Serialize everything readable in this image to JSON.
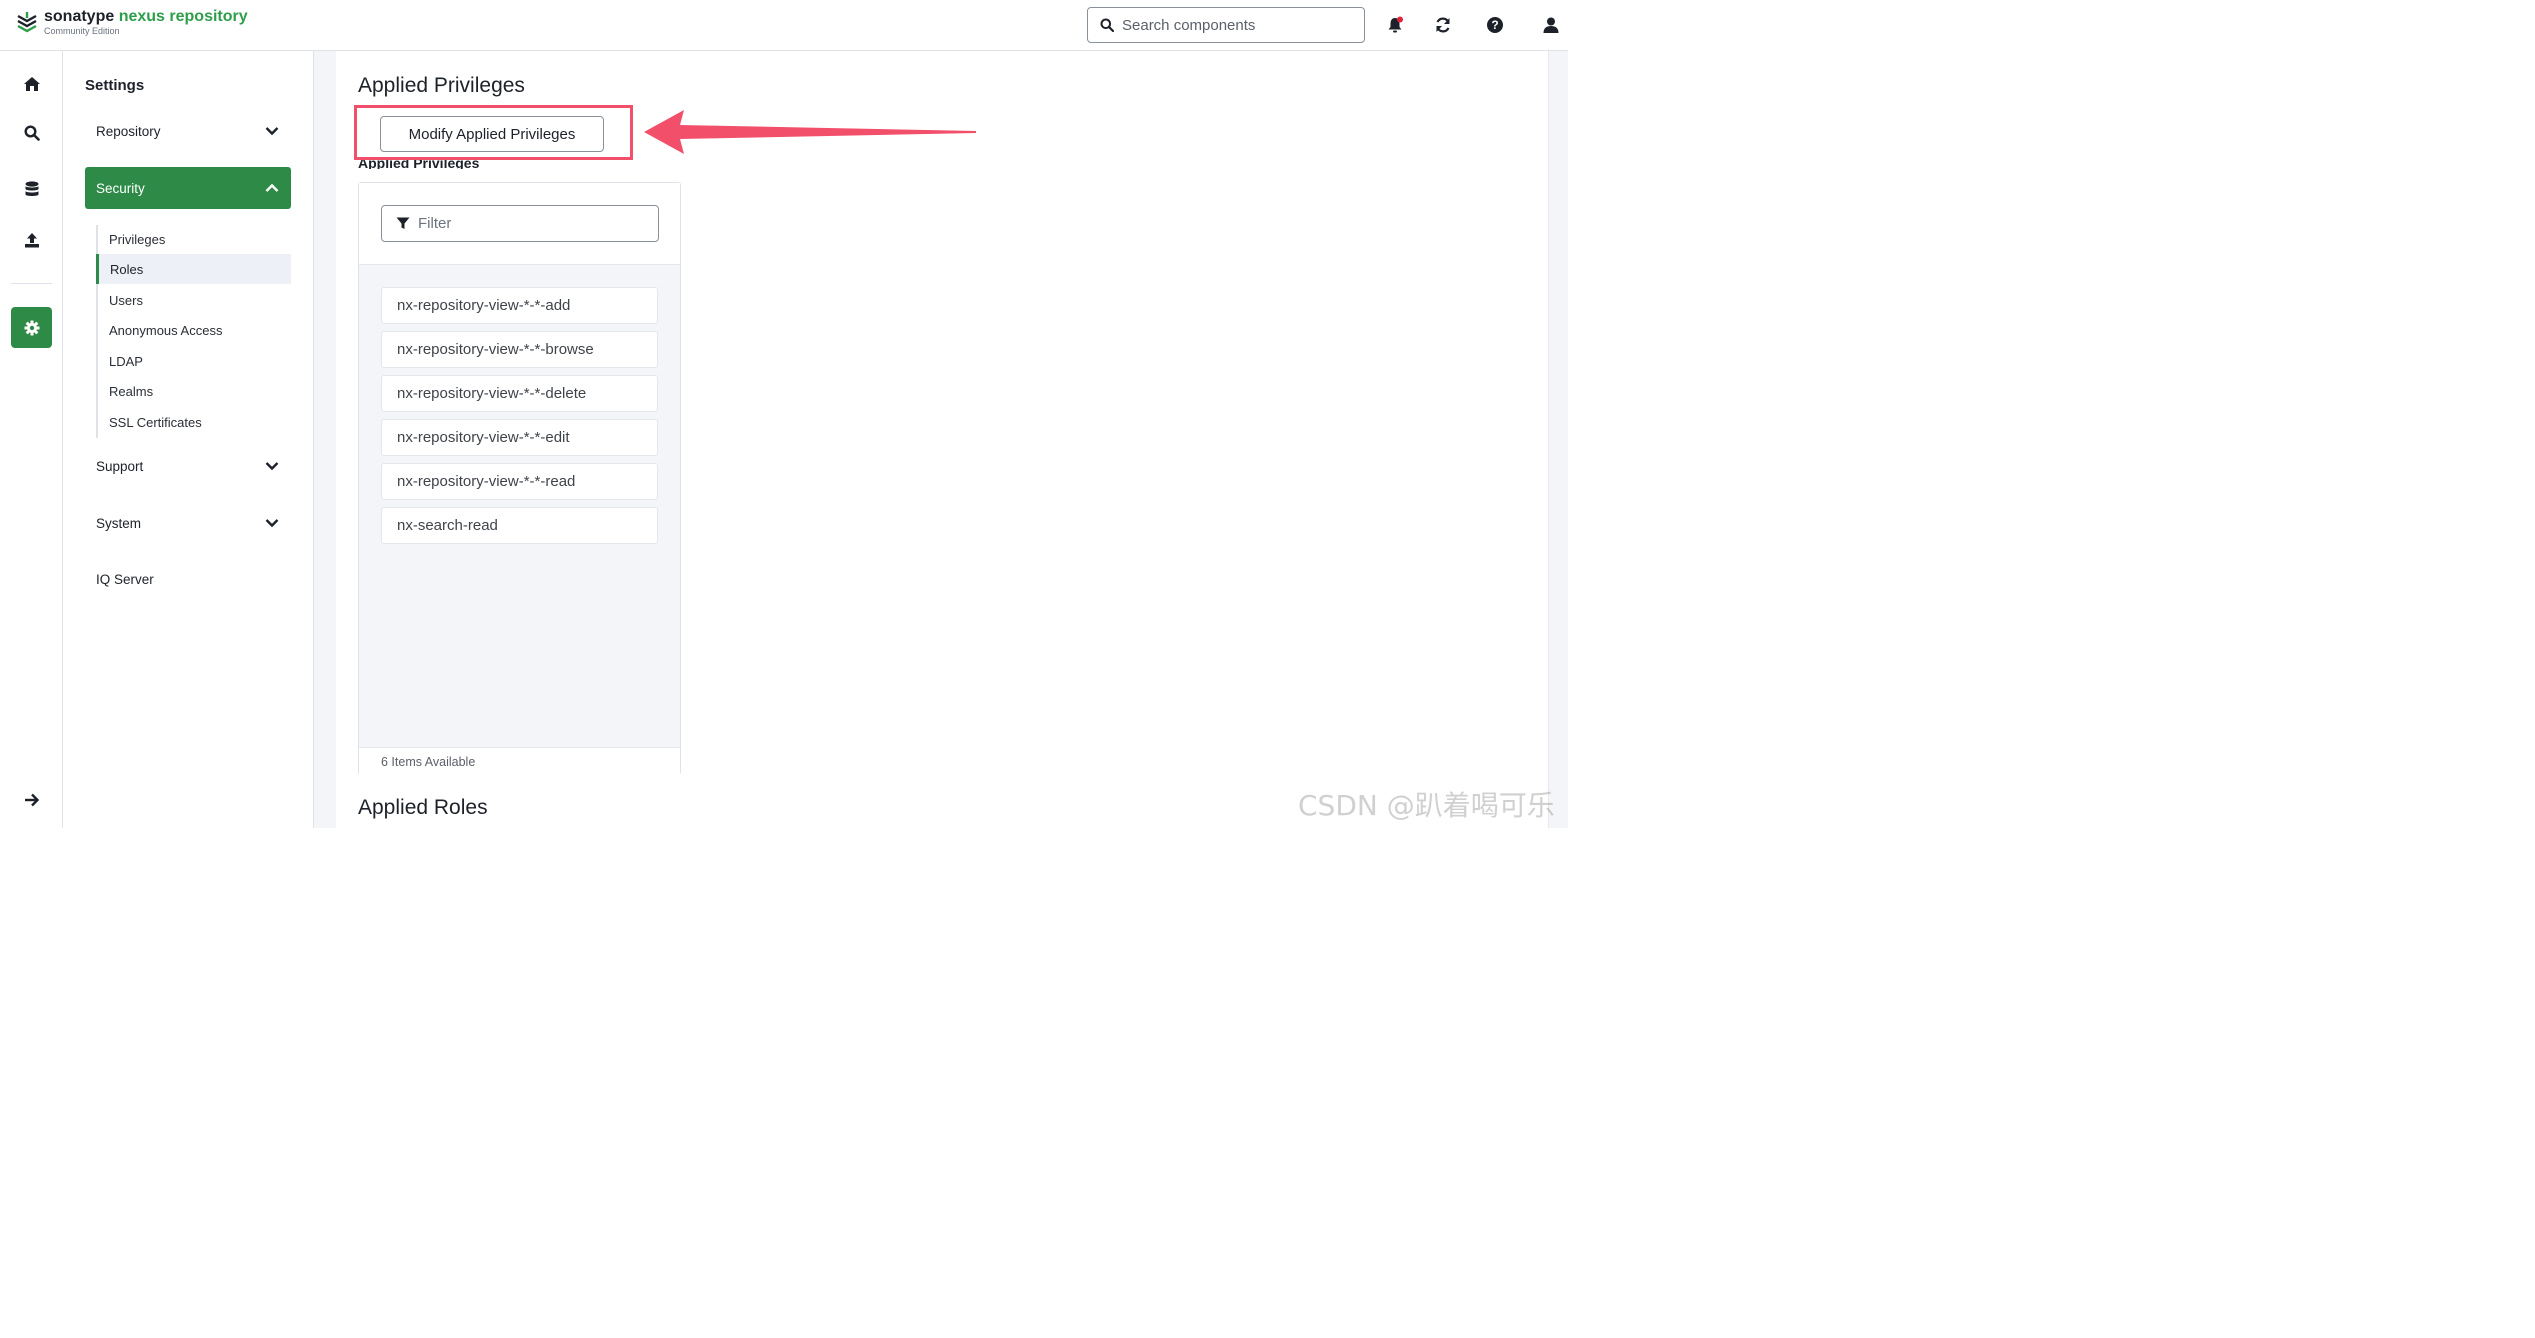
{
  "brand": {
    "name_part1": "sonatype",
    "name_part2": "nexus repository",
    "edition": "Community Edition"
  },
  "header": {
    "search_placeholder": "Search components",
    "icons": [
      "bell-icon",
      "refresh-icon",
      "help-icon",
      "user-icon"
    ]
  },
  "rail": {
    "icons": [
      "home-icon",
      "search-icon",
      "database-icon",
      "upload-icon",
      "gear-icon",
      "expand-arrow-icon"
    ],
    "active": "gear-icon"
  },
  "sidebar": {
    "title": "Settings",
    "sections": [
      {
        "label": "Repository",
        "expanded": false
      },
      {
        "label": "Security",
        "expanded": true
      },
      {
        "label": "Support",
        "expanded": false
      },
      {
        "label": "System",
        "expanded": false
      },
      {
        "label": "IQ Server",
        "expanded": false
      }
    ],
    "security_items": [
      "Privileges",
      "Roles",
      "Users",
      "Anonymous Access",
      "LDAP",
      "Realms",
      "SSL Certificates"
    ],
    "active_item": "Roles"
  },
  "main": {
    "section_title": "Applied Privileges",
    "modify_button": "Modify Applied Privileges",
    "list_title": "Applied Privileges",
    "filter_placeholder": "Filter",
    "privileges": [
      "nx-repository-view-*-*-add",
      "nx-repository-view-*-*-browse",
      "nx-repository-view-*-*-delete",
      "nx-repository-view-*-*-edit",
      "nx-repository-view-*-*-read",
      "nx-search-read"
    ],
    "items_available": "6 Items Available",
    "roles_title": "Applied Roles"
  },
  "annotation": {
    "highlight_color": "#f2506a"
  },
  "watermark": "CSDN @趴着喝可乐",
  "colors": {
    "accent": "#2e8b47",
    "brand_green": "#2e9e4a"
  }
}
